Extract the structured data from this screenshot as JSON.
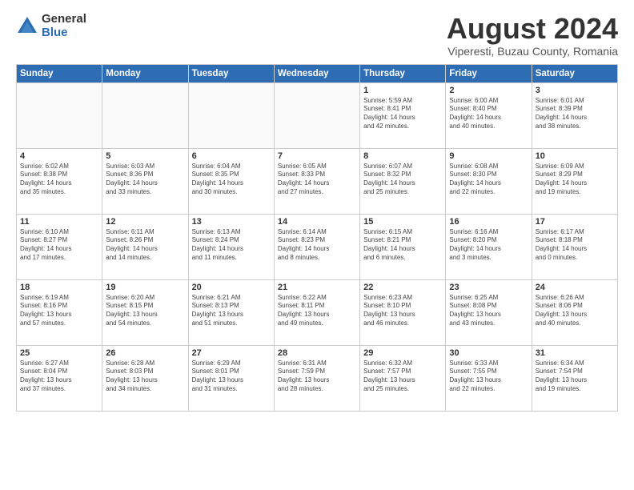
{
  "logo": {
    "general": "General",
    "blue": "Blue"
  },
  "header": {
    "title": "August 2024",
    "subtitle": "Viperesti, Buzau County, Romania"
  },
  "weekdays": [
    "Sunday",
    "Monday",
    "Tuesday",
    "Wednesday",
    "Thursday",
    "Friday",
    "Saturday"
  ],
  "weeks": [
    [
      {
        "day": "",
        "info": ""
      },
      {
        "day": "",
        "info": ""
      },
      {
        "day": "",
        "info": ""
      },
      {
        "day": "",
        "info": ""
      },
      {
        "day": "1",
        "info": "Sunrise: 5:59 AM\nSunset: 8:41 PM\nDaylight: 14 hours\nand 42 minutes."
      },
      {
        "day": "2",
        "info": "Sunrise: 6:00 AM\nSunset: 8:40 PM\nDaylight: 14 hours\nand 40 minutes."
      },
      {
        "day": "3",
        "info": "Sunrise: 6:01 AM\nSunset: 8:39 PM\nDaylight: 14 hours\nand 38 minutes."
      }
    ],
    [
      {
        "day": "4",
        "info": "Sunrise: 6:02 AM\nSunset: 8:38 PM\nDaylight: 14 hours\nand 35 minutes."
      },
      {
        "day": "5",
        "info": "Sunrise: 6:03 AM\nSunset: 8:36 PM\nDaylight: 14 hours\nand 33 minutes."
      },
      {
        "day": "6",
        "info": "Sunrise: 6:04 AM\nSunset: 8:35 PM\nDaylight: 14 hours\nand 30 minutes."
      },
      {
        "day": "7",
        "info": "Sunrise: 6:05 AM\nSunset: 8:33 PM\nDaylight: 14 hours\nand 27 minutes."
      },
      {
        "day": "8",
        "info": "Sunrise: 6:07 AM\nSunset: 8:32 PM\nDaylight: 14 hours\nand 25 minutes."
      },
      {
        "day": "9",
        "info": "Sunrise: 6:08 AM\nSunset: 8:30 PM\nDaylight: 14 hours\nand 22 minutes."
      },
      {
        "day": "10",
        "info": "Sunrise: 6:09 AM\nSunset: 8:29 PM\nDaylight: 14 hours\nand 19 minutes."
      }
    ],
    [
      {
        "day": "11",
        "info": "Sunrise: 6:10 AM\nSunset: 8:27 PM\nDaylight: 14 hours\nand 17 minutes."
      },
      {
        "day": "12",
        "info": "Sunrise: 6:11 AM\nSunset: 8:26 PM\nDaylight: 14 hours\nand 14 minutes."
      },
      {
        "day": "13",
        "info": "Sunrise: 6:13 AM\nSunset: 8:24 PM\nDaylight: 14 hours\nand 11 minutes."
      },
      {
        "day": "14",
        "info": "Sunrise: 6:14 AM\nSunset: 8:23 PM\nDaylight: 14 hours\nand 8 minutes."
      },
      {
        "day": "15",
        "info": "Sunrise: 6:15 AM\nSunset: 8:21 PM\nDaylight: 14 hours\nand 6 minutes."
      },
      {
        "day": "16",
        "info": "Sunrise: 6:16 AM\nSunset: 8:20 PM\nDaylight: 14 hours\nand 3 minutes."
      },
      {
        "day": "17",
        "info": "Sunrise: 6:17 AM\nSunset: 8:18 PM\nDaylight: 14 hours\nand 0 minutes."
      }
    ],
    [
      {
        "day": "18",
        "info": "Sunrise: 6:19 AM\nSunset: 8:16 PM\nDaylight: 13 hours\nand 57 minutes."
      },
      {
        "day": "19",
        "info": "Sunrise: 6:20 AM\nSunset: 8:15 PM\nDaylight: 13 hours\nand 54 minutes."
      },
      {
        "day": "20",
        "info": "Sunrise: 6:21 AM\nSunset: 8:13 PM\nDaylight: 13 hours\nand 51 minutes."
      },
      {
        "day": "21",
        "info": "Sunrise: 6:22 AM\nSunset: 8:11 PM\nDaylight: 13 hours\nand 49 minutes."
      },
      {
        "day": "22",
        "info": "Sunrise: 6:23 AM\nSunset: 8:10 PM\nDaylight: 13 hours\nand 46 minutes."
      },
      {
        "day": "23",
        "info": "Sunrise: 6:25 AM\nSunset: 8:08 PM\nDaylight: 13 hours\nand 43 minutes."
      },
      {
        "day": "24",
        "info": "Sunrise: 6:26 AM\nSunset: 8:06 PM\nDaylight: 13 hours\nand 40 minutes."
      }
    ],
    [
      {
        "day": "25",
        "info": "Sunrise: 6:27 AM\nSunset: 8:04 PM\nDaylight: 13 hours\nand 37 minutes."
      },
      {
        "day": "26",
        "info": "Sunrise: 6:28 AM\nSunset: 8:03 PM\nDaylight: 13 hours\nand 34 minutes."
      },
      {
        "day": "27",
        "info": "Sunrise: 6:29 AM\nSunset: 8:01 PM\nDaylight: 13 hours\nand 31 minutes."
      },
      {
        "day": "28",
        "info": "Sunrise: 6:31 AM\nSunset: 7:59 PM\nDaylight: 13 hours\nand 28 minutes."
      },
      {
        "day": "29",
        "info": "Sunrise: 6:32 AM\nSunset: 7:57 PM\nDaylight: 13 hours\nand 25 minutes."
      },
      {
        "day": "30",
        "info": "Sunrise: 6:33 AM\nSunset: 7:55 PM\nDaylight: 13 hours\nand 22 minutes."
      },
      {
        "day": "31",
        "info": "Sunrise: 6:34 AM\nSunset: 7:54 PM\nDaylight: 13 hours\nand 19 minutes."
      }
    ]
  ]
}
